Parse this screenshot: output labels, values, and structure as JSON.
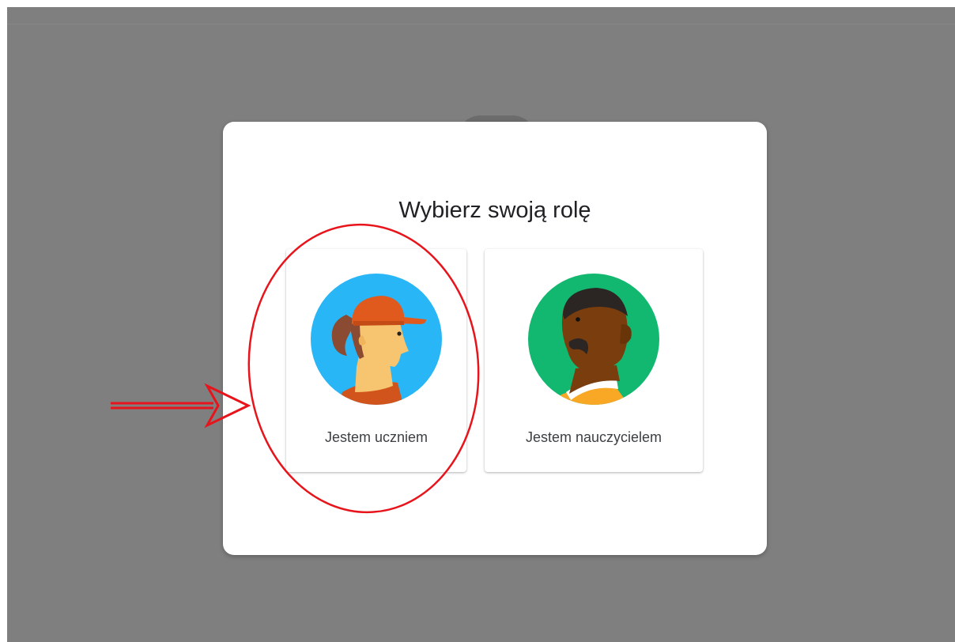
{
  "dialog": {
    "title": "Wybierz swoją rolę"
  },
  "roles": [
    {
      "label": "Jestem uczniem",
      "avatar_icon": "student-avatar-icon"
    },
    {
      "label": "Jestem nauczycielem",
      "avatar_icon": "teacher-avatar-icon"
    }
  ],
  "annotation": {
    "color": "#e8141b",
    "shapes": [
      "highlight-ellipse",
      "pointer-arrow"
    ]
  },
  "colors": {
    "backdrop": "#7f7f7f",
    "student_bg": "#29b6f6",
    "teacher_bg": "#12b86f",
    "cap": "#e05a1e"
  }
}
